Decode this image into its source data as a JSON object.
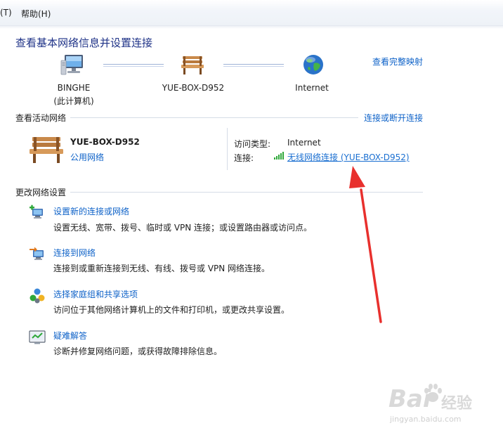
{
  "menu": {
    "tools_partial": "(T)",
    "help": "帮助(H)"
  },
  "page_title": "查看基本网络信息并设置连接",
  "full_map_link": "查看完整映射",
  "map": {
    "computer_name": "BINGHE",
    "computer_sub": "(此计算机)",
    "router_name": "YUE-BOX-D952",
    "internet_name": "Internet"
  },
  "active_networks": {
    "section_label": "查看活动网络",
    "connect_link": "连接或断开连接",
    "network_name": "YUE-BOX-D952",
    "network_type_link": "公用网络",
    "access_type_label": "访问类型:",
    "access_type_value": "Internet",
    "connections_label": "连接:",
    "connection_link": "无线网络连接 (YUE-BOX-D952)"
  },
  "change_settings": {
    "section_label": "更改网络设置",
    "tasks": [
      {
        "title": "设置新的连接或网络",
        "desc": "设置无线、宽带、拨号、临时或 VPN 连接；或设置路由器或访问点。",
        "icon": "new-connection-icon"
      },
      {
        "title": "连接到网络",
        "desc": "连接到或重新连接到无线、有线、拨号或 VPN 网络连接。",
        "icon": "connect-network-icon"
      },
      {
        "title": "选择家庭组和共享选项",
        "desc": "访问位于其他网络计算机上的文件和打印机，或更改共享设置。",
        "icon": "homegroup-icon"
      },
      {
        "title": "疑难解答",
        "desc": "诊断并修复网络问题，或获得故障排除信息。",
        "icon": "troubleshoot-icon"
      }
    ]
  },
  "annotation": {
    "color": "#e8302d"
  },
  "watermark": {
    "brand": "Bai",
    "brand2": "经验",
    "url": "jingyan.baidu.com"
  }
}
